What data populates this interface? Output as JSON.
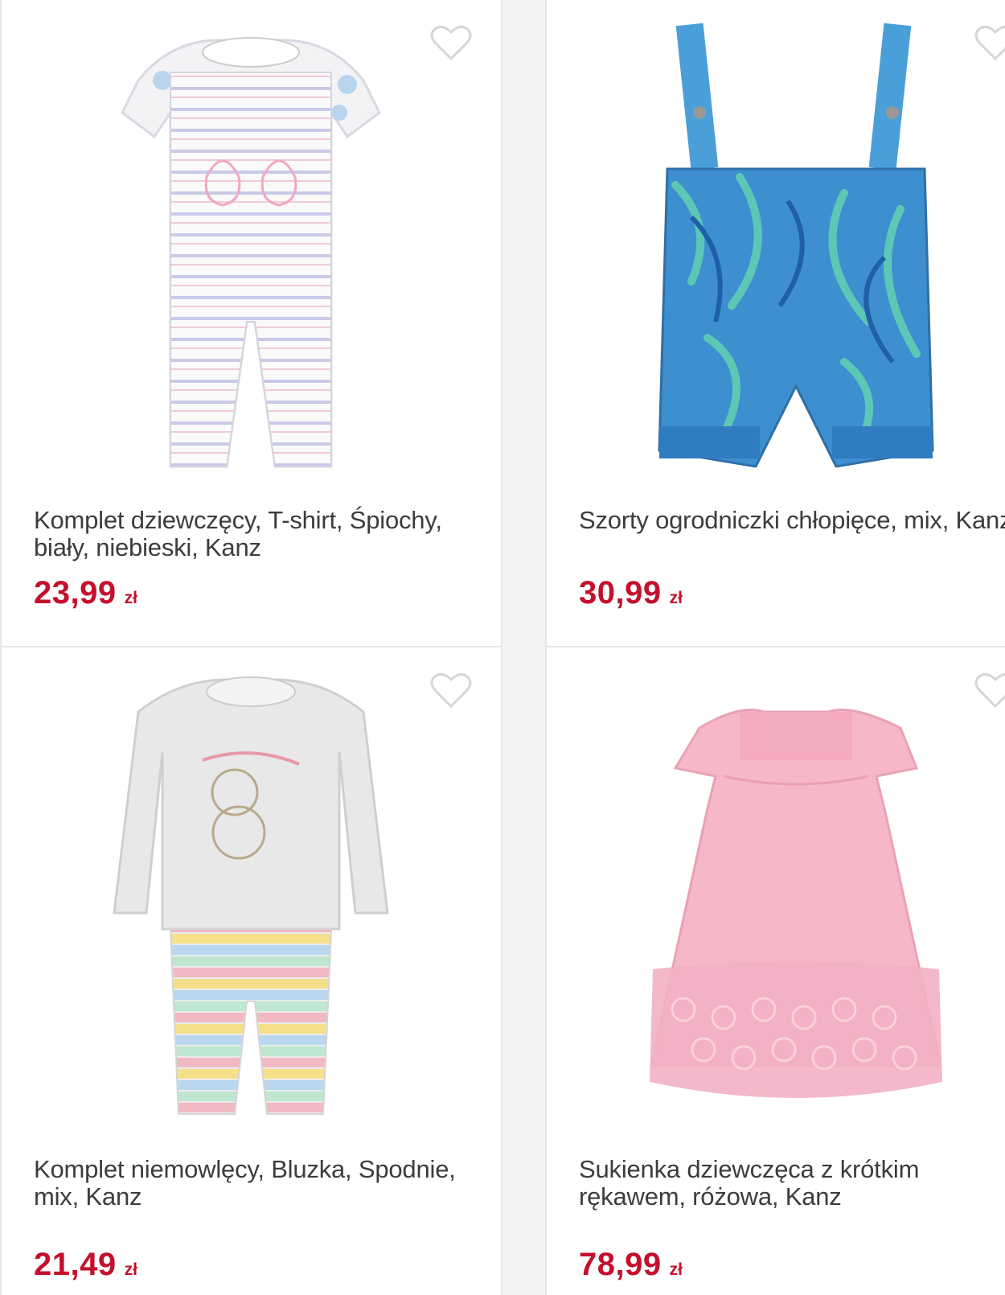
{
  "colors": {
    "price": "#c4102b",
    "title": "#3c3c3c",
    "heart_outline": "#d6d6d6",
    "divider": "#e6e6e6"
  },
  "products": [
    {
      "title": "Komplet dziewczęcy, T-shirt, Śpiochy, biały, niebieski, Kanz",
      "price": "23,99",
      "currency": "zł",
      "image_icon": "romper-set-image",
      "favorite_icon": "heart-outline-icon"
    },
    {
      "title": "Szorty ogrodniczki chłopięce, mix, Kanz",
      "price": "30,99",
      "currency": "zł",
      "image_icon": "dungaree-shorts-image",
      "favorite_icon": "heart-outline-icon"
    },
    {
      "title": "Komplet niemowlęcy, Bluzka, Spodnie, mix, Kanz",
      "price": "21,49",
      "currency": "zł",
      "image_icon": "baby-set-image",
      "favorite_icon": "heart-outline-icon"
    },
    {
      "title": "Sukienka dziewczęca z krótkim rękawem, różowa, Kanz",
      "price": "78,99",
      "currency": "zł",
      "image_icon": "pink-dress-image",
      "favorite_icon": "heart-outline-icon"
    }
  ]
}
